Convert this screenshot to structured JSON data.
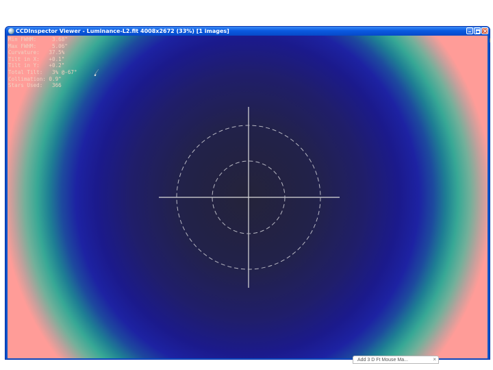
{
  "window": {
    "title": "CCDInspector Viewer - Luminance-L2.fit 4008x2672 (33%)  [1 images]",
    "buttons": [
      "minimize",
      "maximize",
      "close"
    ]
  },
  "stats": [
    "Min FWHM:     3.68\"",
    "Max FWHM:     5.06\"",
    "Curvature:   37.5%",
    "Tilt in X:   +0.1\"",
    "Tilt in Y:   +0.2\"",
    "Total Tilt:   3% @-67°",
    "Collimation: 0.9\"",
    "Stars Used:   366"
  ],
  "colors": {
    "stats_text": "#f2d2c2",
    "crosshair": "#dcdcdc",
    "center": "#24233a",
    "mid": "#1b1a8c",
    "teal": "#37a895",
    "corner": "#ff9c98"
  },
  "icons": {
    "app": "ccdinspector-app-icon",
    "cursor": "mouse-pointer-icon"
  },
  "taskbar": {
    "label": "Add  3  D  Ft  Mouse  Ma...",
    "close": "×"
  }
}
